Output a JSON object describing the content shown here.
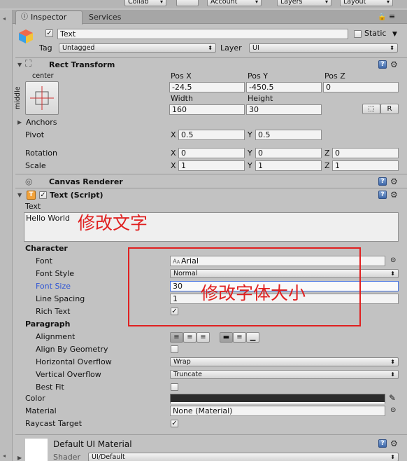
{
  "topbar": {
    "collab": "Collab",
    "account": "Account",
    "layers": "Layers",
    "layout": "Layout"
  },
  "tabs": {
    "inspector": "Inspector",
    "services": "Services"
  },
  "header": {
    "object_name": "Text",
    "static_label": "Static",
    "tag_label": "Tag",
    "tag_value": "Untagged",
    "layer_label": "Layer",
    "layer_value": "UI"
  },
  "rect_transform": {
    "title": "Rect Transform",
    "anchor_h": "center",
    "anchor_v": "middle",
    "pos_x_label": "Pos X",
    "pos_y_label": "Pos Y",
    "pos_z_label": "Pos Z",
    "pos_x": "-24.5",
    "pos_y": "-450.5",
    "pos_z": "0",
    "width_label": "Width",
    "height_label": "Height",
    "width": "160",
    "height": "30",
    "r_button": "R",
    "anchors_label": "Anchors",
    "pivot_label": "Pivot",
    "pivot_x": "0.5",
    "pivot_y": "0.5",
    "rotation_label": "Rotation",
    "rot_x": "0",
    "rot_y": "0",
    "rot_z": "0",
    "scale_label": "Scale",
    "scale_x": "1",
    "scale_y": "1",
    "scale_z": "1",
    "x": "X",
    "y": "Y",
    "z": "Z"
  },
  "canvas_renderer": {
    "title": "Canvas Renderer"
  },
  "text_script": {
    "title": "Text (Script)",
    "text_label": "Text",
    "text_value": "Hello World",
    "character_label": "Character",
    "font_label": "Font",
    "font_value": "Arial",
    "font_style_label": "Font Style",
    "font_style_value": "Normal",
    "font_size_label": "Font Size",
    "font_size_value": "30",
    "line_spacing_label": "Line Spacing",
    "line_spacing_value": "1",
    "rich_text_label": "Rich Text",
    "paragraph_label": "Paragraph",
    "alignment_label": "Alignment",
    "align_by_geometry_label": "Align By Geometry",
    "horizontal_overflow_label": "Horizontal Overflow",
    "horizontal_overflow_value": "Wrap",
    "vertical_overflow_label": "Vertical Overflow",
    "vertical_overflow_value": "Truncate",
    "best_fit_label": "Best Fit",
    "color_label": "Color",
    "color_value": "#2b2b2b",
    "material_label": "Material",
    "material_value": "None (Material)",
    "raycast_label": "Raycast Target"
  },
  "material_section": {
    "title": "Default UI Material",
    "shader_label": "Shader",
    "shader_value": "UI/Default"
  },
  "annotations": {
    "edit_text": "修改文字",
    "edit_font_size": "修改字体大小"
  },
  "colors": {
    "annotation_red": "#e02020",
    "selected_label": "#2f55d4",
    "panel_bg": "#c2c2c2"
  }
}
